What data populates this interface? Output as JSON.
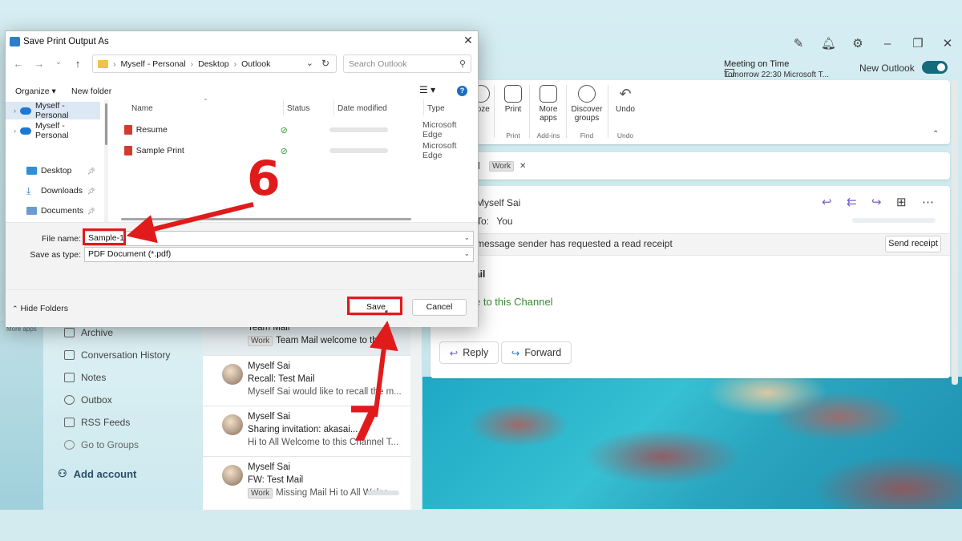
{
  "dialog": {
    "title": "Save Print Output As",
    "close_label": "✕",
    "breadcrumb": [
      "Myself - Personal",
      "Desktop",
      "Outlook"
    ],
    "search_placeholder": "Search Outlook",
    "organize_label": "Organize ▾",
    "new_folder_label": "New folder",
    "help_label": "?",
    "tree": [
      {
        "label": "Myself - Personal",
        "selected": true
      },
      {
        "label": "Myself - Personal",
        "selected": false
      },
      {
        "label": "Desktop",
        "selected": false
      },
      {
        "label": "Downloads",
        "selected": false
      },
      {
        "label": "Documents",
        "selected": false
      }
    ],
    "columns": {
      "name": "Name",
      "status": "Status",
      "date": "Date modified",
      "type": "Type"
    },
    "files": [
      {
        "name": "Resume",
        "type": "Microsoft Edge"
      },
      {
        "name": "Sample Print",
        "type": "Microsoft Edge"
      }
    ],
    "file_name_label": "File name:",
    "file_name_value": "Sample-1",
    "save_as_type_label": "Save as type:",
    "save_as_type_value": "PDF Document (*.pdf)",
    "hide_folders_label": "Hide Folders",
    "save_label": "Save",
    "cancel_label": "Cancel"
  },
  "annotations": {
    "step6": "6",
    "step7": "7",
    "color": "#e11b1b"
  },
  "outlook": {
    "meeting_title": "Meeting on Time",
    "meeting_detail": "Tomorrow 22:30 Microsoft T...",
    "new_outlook_label": "New Outlook",
    "ribbon": [
      {
        "label": "ooze",
        "group": ""
      },
      {
        "label": "Print",
        "group": "Print"
      },
      {
        "label": "More apps",
        "group": "Add-ins"
      },
      {
        "label": "Discover groups",
        "group": "Find"
      },
      {
        "label": "Undo",
        "group": "Undo"
      }
    ],
    "subject_title": "il",
    "subject_tag": "Work",
    "from": "Myself Sai",
    "to_label": "To:",
    "to_value": "You",
    "read_receipt_text": "message sender has requested a read receipt",
    "send_receipt_label": "Send receipt",
    "body_title": "ail",
    "body_text": "e to this Channel",
    "reply_label": "Reply",
    "forward_label": "Forward",
    "more_apps_label": "More apps",
    "nav": [
      "Archive",
      "Conversation History",
      "Notes",
      "Outbox",
      "RSS Feeds",
      "Go to Groups"
    ],
    "add_account_label": "Add account",
    "mail_list": [
      {
        "from": "Team Mail",
        "subject": "",
        "preview": "Team Mail welcome to th",
        "tag": "Work"
      },
      {
        "from": "Myself Sai",
        "subject": "Recall: Test Mail",
        "preview": "Myself Sai would like to recall the m...",
        "tag": ""
      },
      {
        "from": "Myself Sai",
        "subject": "Sharing invitation: akasai...",
        "preview": "Hi to All Welcome to this Channel T...",
        "tag": ""
      },
      {
        "from": "Myself Sai",
        "subject": "FW: Test Mail",
        "preview": "Missing Mail Hi to All Welco...",
        "tag": "Work"
      }
    ]
  }
}
